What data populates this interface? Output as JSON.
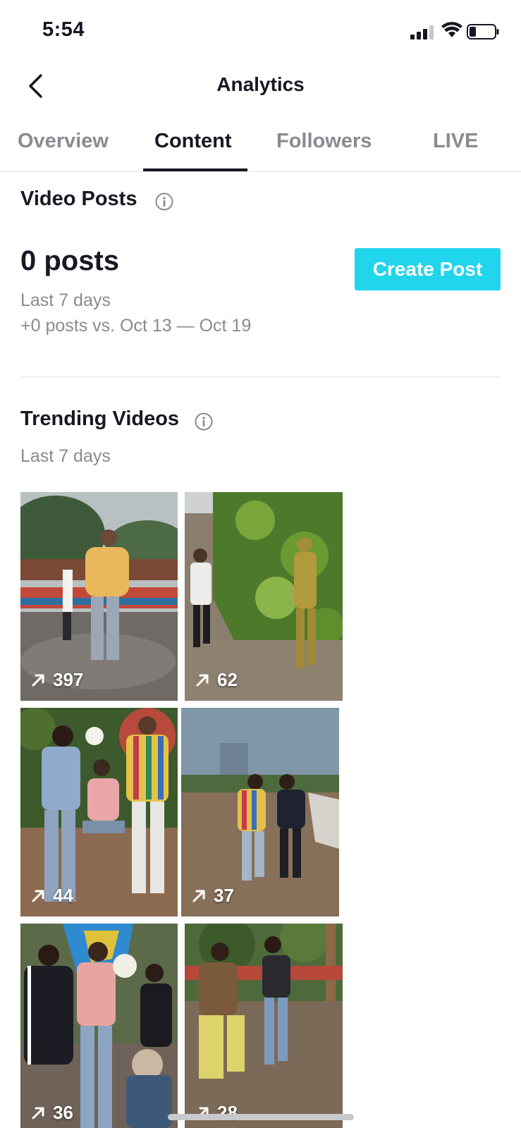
{
  "status": {
    "time": "5:54"
  },
  "nav": {
    "title": "Analytics",
    "back_icon": "chevron-left-icon"
  },
  "tabs": [
    {
      "label": "Overview",
      "active": false
    },
    {
      "label": "Content",
      "active": true
    },
    {
      "label": "Followers",
      "active": false
    },
    {
      "label": "LIVE",
      "active": false
    }
  ],
  "video_posts": {
    "title": "Video Posts",
    "count": "0 posts",
    "period": "Last 7 days",
    "comparison": "+0 posts vs. Oct 13 — Oct 19",
    "create_button": "Create Post"
  },
  "trending": {
    "title": "Trending Videos",
    "period": "Last 7 days",
    "videos": [
      {
        "views": "397"
      },
      {
        "views": "62"
      },
      {
        "views": "44"
      },
      {
        "views": "37"
      },
      {
        "views": "36"
      },
      {
        "views": "28"
      }
    ]
  },
  "colors": {
    "accent": "#20d5ec",
    "text_primary": "#161823",
    "text_secondary": "#8a8b91"
  }
}
